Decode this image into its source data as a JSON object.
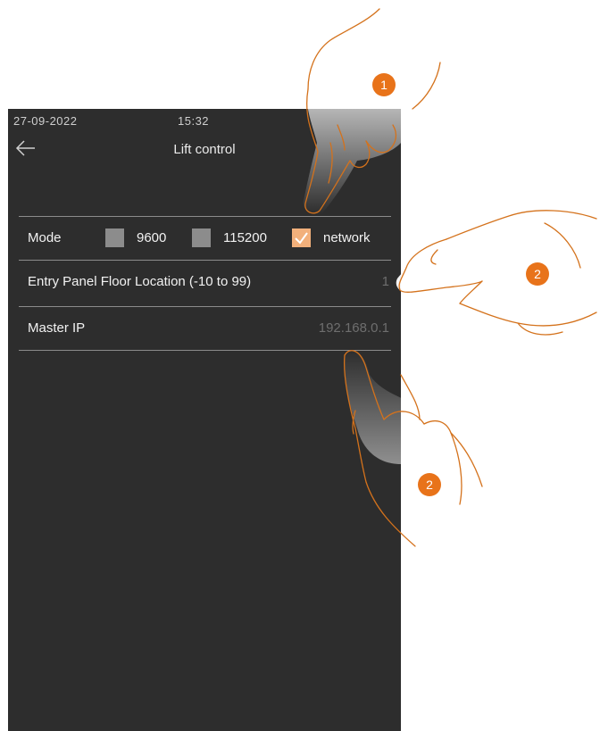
{
  "status_bar": {
    "date": "27-09-2022",
    "time": "15:32"
  },
  "header": {
    "title": "Lift control"
  },
  "mode": {
    "label": "Mode",
    "options": [
      {
        "label": "9600",
        "checked": false
      },
      {
        "label": "115200",
        "checked": false
      },
      {
        "label": "network",
        "checked": true
      }
    ]
  },
  "floor_location": {
    "label": "Entry Panel Floor Location (-10 to 99)",
    "value": "1"
  },
  "master_ip": {
    "label": "Master IP",
    "value": "192.168.0.1"
  },
  "callouts": {
    "badge_1": "1",
    "badge_2a": "2",
    "badge_2b": "2"
  },
  "colors": {
    "screen_bg": "#2d2d2d",
    "checkbox_checked": "#f2b07b",
    "checkbox_unchecked": "#8c8c8c",
    "badge": "#e8731a",
    "hand_outline": "#d4721c"
  }
}
